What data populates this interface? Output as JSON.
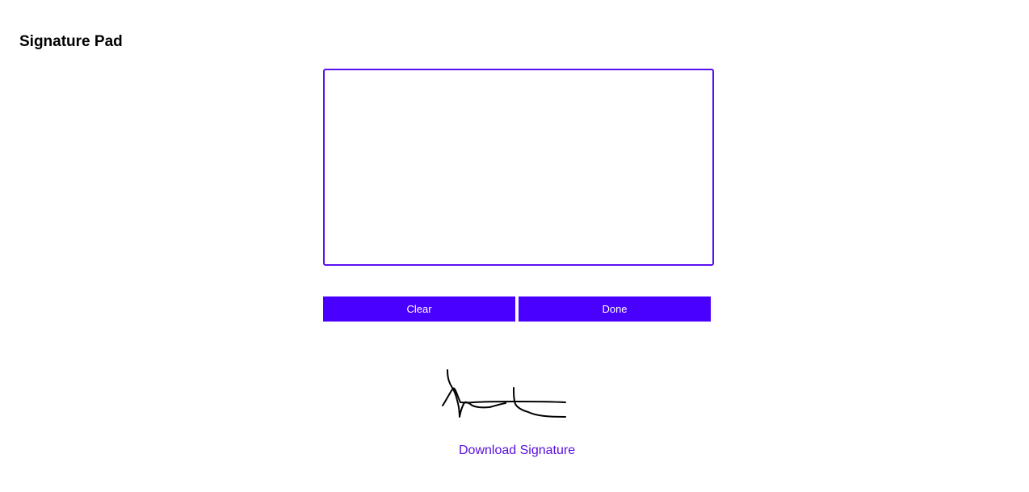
{
  "page": {
    "title": "Signature Pad"
  },
  "buttons": {
    "clear_label": "Clear",
    "done_label": "Done"
  },
  "download": {
    "label": "Download Signature"
  },
  "colors": {
    "accent": "#4a00ff",
    "pad_border": "#5a10f0",
    "link": "#5a10e0",
    "ink": "#000000"
  }
}
